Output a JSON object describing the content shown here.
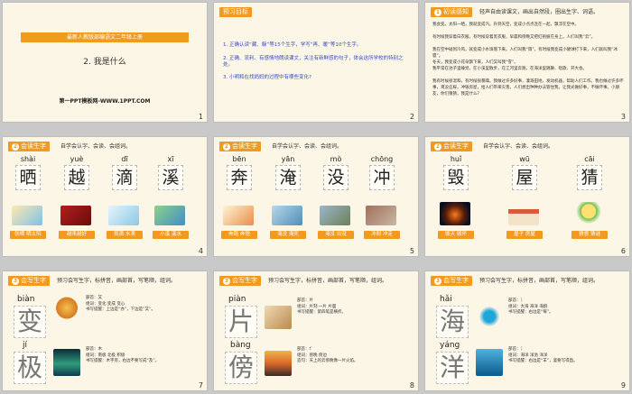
{
  "slides": [
    {
      "num": "1",
      "banner": "最新人教版部编语文二年级上册",
      "title": "2. 我是什么",
      "site": "第一PPT模板网-WWW.1PPT.COM"
    },
    {
      "num": "2",
      "tag": "预习目标",
      "lines": [
        "1. 正确认读“藏、躲”等15个生字，学写“再、暖”等10个生字。",
        "2. 正确、流利、有感情地朗读课文，关注有新鲜感的句子，体会这所学校的特别之处。",
        "3. 小明和在找妈妈的过程中有哪些变化?"
      ]
    },
    {
      "num": "3",
      "tag": "初读感知",
      "tagnum": "1",
      "desc": "轻声自由读课文，画出自然段，圈出生字、词语。",
      "paras": [
        "我会变。太阳一晒，我就变成汽。升到天空，变成小点点连在一起，飘浮在空中。",
        "有时候我穿着白衣服，有时候穿着黑衣服，早晨和傍晚又把红袍披在身上。人们叫我“云”。",
        "我在空中碰到冷风，就变成小水珠落下来。人们叫我“雨”。有时候我变成小硬球打下来，人们就叫我“冰雹”。",
        "冬天，我变成小花朵飘下来，人们又叫我“雪”。",
        "我平常在池子里睡觉，在小溪里散步，在江河里奔跑，在海洋里跳舞、唱歌、开大会。",
        "我有时候很温和，有时候很暴躁。我做过许多好事，灌溉田地，发动机器，帮助人们工作。我也做过许多坏事，淹没庄稼，冲毁房屋，给人们带来灾害。人们想出种种办法管住我，让我光做好事，不做坏事。小朋友，你们猜猜，我是什么?"
      ]
    },
    {
      "num": "4",
      "tag": "会读生字",
      "tagnum": "2",
      "desc": "自学会认字、会读、会组词。",
      "chars": [
        {
          "py": "shài",
          "ch": "晒",
          "w": "防晒 晒太阳"
        },
        {
          "py": "yuè",
          "ch": "越",
          "w": "越来越好"
        },
        {
          "py": "dī",
          "ch": "滴",
          "w": "雨滴 水滴"
        },
        {
          "py": "xī",
          "ch": "溪",
          "w": "小溪 溪水"
        }
      ]
    },
    {
      "num": "5",
      "tag": "会读生字",
      "tagnum": "2",
      "desc": "自学会认字、会读、会组词。",
      "chars": [
        {
          "py": "bēn",
          "ch": "奔",
          "w": "奔跑 奔驰"
        },
        {
          "py": "yān",
          "ch": "淹",
          "w": "淹没 淹死"
        },
        {
          "py": "mò",
          "ch": "没",
          "w": "淹没 出没"
        },
        {
          "py": "chōng",
          "ch": "冲",
          "w": "冲刺 冲走"
        }
      ]
    },
    {
      "num": "6",
      "tag": "会读生字",
      "tagnum": "2",
      "desc": "自学会认字、会读、会组词。",
      "chars": [
        {
          "py": "huǐ",
          "ch": "毁",
          "w": "毁灭 毁坏"
        },
        {
          "py": "wū",
          "ch": "屋",
          "w": "屋子 房屋"
        },
        {
          "py": "cāi",
          "ch": "猜",
          "w": "猜想 猜谜"
        }
      ]
    },
    {
      "num": "7",
      "tag": "会写生字",
      "tagnum": "3",
      "desc": "预习会写生字，标拼音，画部首，写笔顺，组词。",
      "chars": [
        {
          "py": "biàn",
          "ch": "变",
          "info": [
            "部首：又",
            "组词：变化 变成 变心",
            "书写提醒：上边是“亦”，下边是“又”。"
          ]
        },
        {
          "py": "jí",
          "ch": "极",
          "info": [
            "部首：木",
            "组词：南极 北极 积极",
            "书写提醒：木字旁，右边不要写成“及”。"
          ]
        }
      ]
    },
    {
      "num": "8",
      "tag": "会写生字",
      "tagnum": "3",
      "desc": "预习会写生字，标拼音，画部首，写笔顺，组词。",
      "chars": [
        {
          "py": "piàn",
          "ch": "片",
          "info": [
            "部首：片",
            "组词：片刻 一片 片面",
            "书写提醒：第四笔是横折。"
          ]
        },
        {
          "py": "bàng",
          "ch": "傍",
          "info": [
            "部首：亻",
            "组词：傍晚 傍边",
            "造句：天上的云傍晚像一片火焰。"
          ]
        }
      ]
    },
    {
      "num": "9",
      "tag": "会写生字",
      "tagnum": "3",
      "desc": "预习会写生字，标拼音，画部首，写笔顺，组词。",
      "chars": [
        {
          "py": "hǎi",
          "ch": "海",
          "info": [
            "部首：氵",
            "组词：大海 海洋 海鸥",
            "书写提醒：右边是“每”。"
          ]
        },
        {
          "py": "yáng",
          "ch": "洋",
          "info": [
            "部首：氵",
            "组词：海洋 洋溢 洋洋",
            "书写提醒：右边是“羊”，竖要写得直。"
          ]
        }
      ]
    }
  ]
}
